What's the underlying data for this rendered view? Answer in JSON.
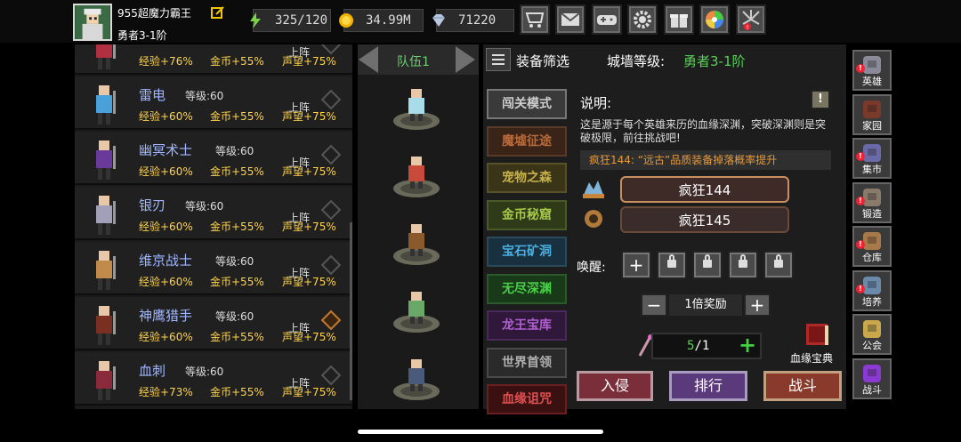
{
  "player": {
    "name": "955超魔力霸王",
    "rank": "勇者3-1阶"
  },
  "resources": {
    "stamina": "325/120",
    "gold": "34.99M",
    "gems": "71220"
  },
  "top_buttons": [
    "shop-icon",
    "mail-icon",
    "gamepad-icon",
    "gear-icon",
    "gift-icon",
    "color-wheel-icon",
    "firework-icon"
  ],
  "heroes": [
    {
      "name": "",
      "level": "",
      "exp": "经验+76%",
      "gold": "金币+55%",
      "rep": "声望+75%",
      "up": "上阵"
    },
    {
      "name": "雷电",
      "level": "等级:60",
      "exp": "经验+60%",
      "gold": "金币+55%",
      "rep": "声望+75%",
      "up": "上阵"
    },
    {
      "name": "幽冥术士",
      "level": "等级:60",
      "exp": "经验+60%",
      "gold": "金币+55%",
      "rep": "声望+75%",
      "up": "上阵"
    },
    {
      "name": "银刃",
      "level": "等级:60",
      "exp": "经验+60%",
      "gold": "金币+55%",
      "rep": "声望+75%",
      "up": "上阵"
    },
    {
      "name": "维京战士",
      "level": "等级:60",
      "exp": "经验+60%",
      "gold": "金币+55%",
      "rep": "声望+75%",
      "up": "上阵"
    },
    {
      "name": "神鹰猎手",
      "level": "等级:60",
      "exp": "经验+60%",
      "gold": "金币+55%",
      "rep": "声望+75%",
      "up": "上阵"
    },
    {
      "name": "血刺",
      "level": "等级:60",
      "exp": "经验+73%",
      "gold": "金币+55%",
      "rep": "声望+75%",
      "up": "上阵"
    }
  ],
  "team": {
    "label": "队伍1"
  },
  "panel": {
    "filter": "装备筛选",
    "wall_label": "城墙等级:",
    "wall_value": "勇者3-1阶",
    "desc_title": "说明:",
    "desc_text": "这是源于每个英雄来历的血缘深渊，突破深渊则是突破极限，前往挑战吧!",
    "notice": "疯狂144: “远古”品质装备掉落概率提升",
    "stages": [
      "疯狂144",
      "疯狂145"
    ],
    "awaken_label": "唤醒:",
    "multiplier": "1倍奖励",
    "count_cur": "5",
    "count_sep": "/1",
    "book_label": "血缘宝典",
    "actions": [
      "入侵",
      "排行",
      "战斗"
    ]
  },
  "modes": [
    "闯关模式",
    "魔墟征途",
    "宠物之森",
    "金币秘窟",
    "宝石矿洞",
    "无尽深渊",
    "龙王宝库",
    "世界首领",
    "血缘诅咒"
  ],
  "sidebar": [
    "英雄",
    "家园",
    "集市",
    "锻造",
    "仓库",
    "培养",
    "公会",
    "战斗"
  ]
}
